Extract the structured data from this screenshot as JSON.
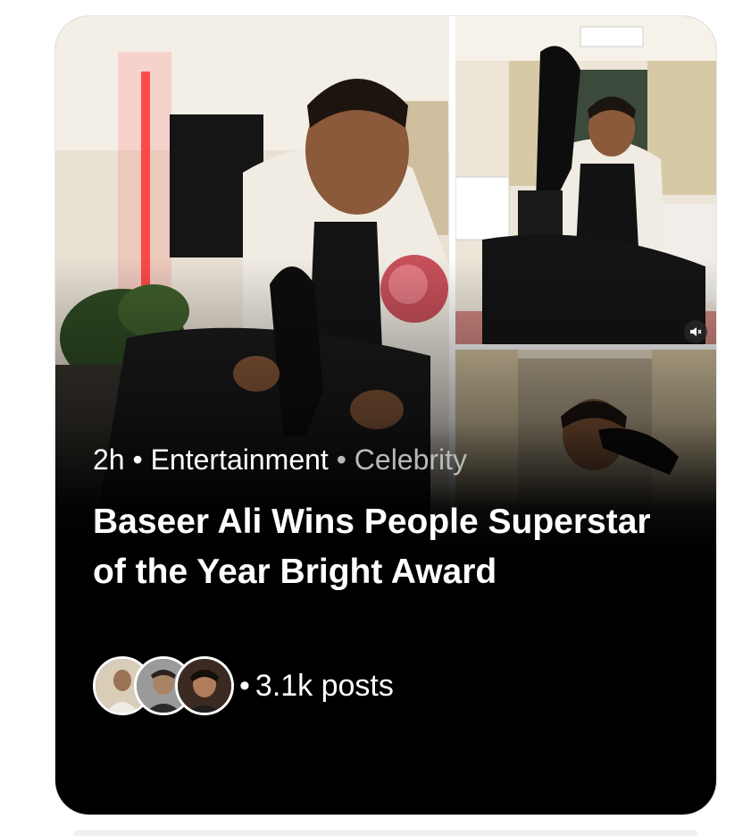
{
  "card": {
    "time": "2h",
    "separator": "•",
    "category": "Entertainment",
    "subcategory": "Celebrity",
    "headline": "Baseer Ali Wins People Superstar of the Year Bright Award",
    "posts_separator": "•",
    "posts_count": "3.1k posts",
    "mute_icon": "speaker-muted-icon"
  },
  "colors": {
    "card_background": "#000000",
    "text_primary": "#ffffff",
    "text_secondary": "#b9b9b9",
    "page_background": "#ffffff"
  }
}
